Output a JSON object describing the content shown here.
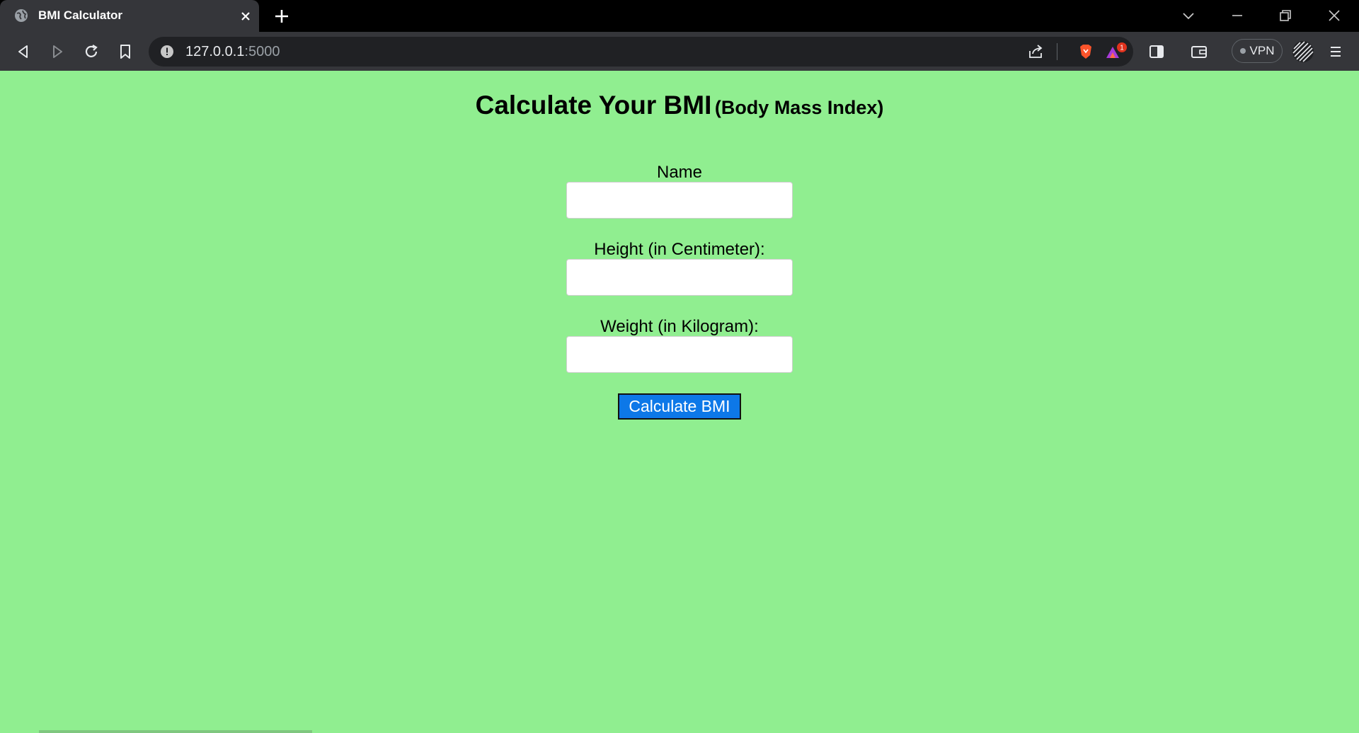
{
  "browser": {
    "tab_title": "BMI Calculator",
    "url_host": "127.0.0.1",
    "url_port": ":5000",
    "vpn_label": "VPN",
    "rewards_badge": "1",
    "colors": {
      "chrome": "#35363a",
      "tabstrip": "#000000",
      "omnibox": "#202124"
    }
  },
  "page": {
    "background": "#90ee90",
    "title": "Calculate Your BMI",
    "subtitle": "(Body Mass Index)",
    "fields": [
      {
        "label": "Name",
        "value": ""
      },
      {
        "label": "Height (in Centimeter):",
        "value": ""
      },
      {
        "label": "Weight (in Kilogram):",
        "value": ""
      }
    ],
    "submit_label": "Calculate BMI",
    "submit_color": "#0d78e8"
  }
}
